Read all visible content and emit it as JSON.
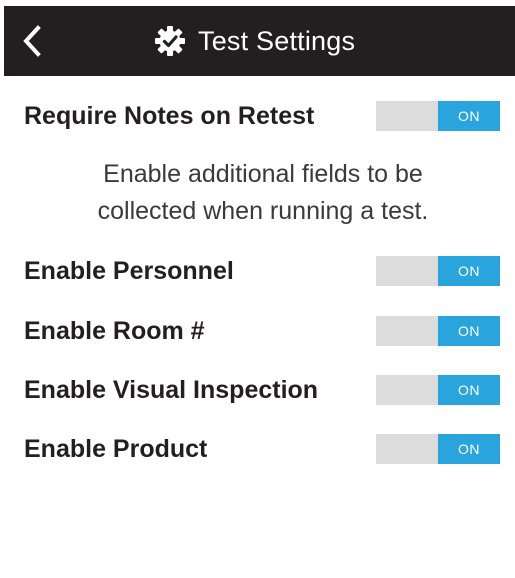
{
  "header": {
    "title": "Test Settings",
    "back_icon": "chevron-left-icon",
    "title_icon": "gear-check-icon",
    "background_color": "#231f20"
  },
  "settings": {
    "retest": {
      "label": "Require Notes on Retest",
      "state": "ON"
    },
    "description": {
      "line1": "Enable additional fields to be",
      "line2": "collected when running a test."
    },
    "personnel": {
      "label": "Enable Personnel",
      "state": "ON"
    },
    "room": {
      "label": "Enable Room #",
      "state": "ON"
    },
    "visual": {
      "label": "Enable Visual Inspection",
      "state": "ON"
    },
    "product": {
      "label": "Enable Product",
      "state": "ON"
    }
  },
  "colors": {
    "toggle_on": "#2aa4dc",
    "toggle_track": "#dcdcdc",
    "label_text": "#231f20"
  }
}
